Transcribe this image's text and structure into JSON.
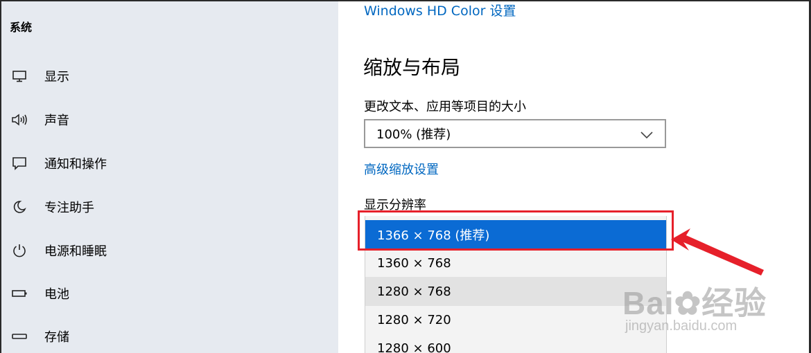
{
  "sidebar": {
    "title": "系统",
    "items": [
      {
        "label": "显示",
        "icon": "monitor-icon"
      },
      {
        "label": "声音",
        "icon": "speaker-icon"
      },
      {
        "label": "通知和操作",
        "icon": "notification-icon"
      },
      {
        "label": "专注助手",
        "icon": "moon-icon"
      },
      {
        "label": "电源和睡眠",
        "icon": "power-icon"
      },
      {
        "label": "电池",
        "icon": "battery-icon"
      },
      {
        "label": "存储",
        "icon": "storage-icon"
      }
    ]
  },
  "main": {
    "hd_color_link": "Windows HD Color 设置",
    "section_title": "缩放与布局",
    "scale_label": "更改文本、应用等项目的大小",
    "scale_value": "100% (推荐)",
    "advanced_link": "高级缩放设置",
    "resolution_label": "显示分辨率",
    "resolution_options": [
      "1366 × 768 (推荐)",
      "1360 × 768",
      "1280 × 768",
      "1280 × 720",
      "1280 × 600"
    ]
  },
  "watermark": {
    "brand": "Bai",
    "brand_suffix": "经验",
    "url": "jingyan.baidu.com"
  },
  "colors": {
    "accent": "#0067c0",
    "selected_bg": "#0b6bd4",
    "highlight": "#e6202a",
    "sidebar_bg": "#e6eaf0"
  }
}
